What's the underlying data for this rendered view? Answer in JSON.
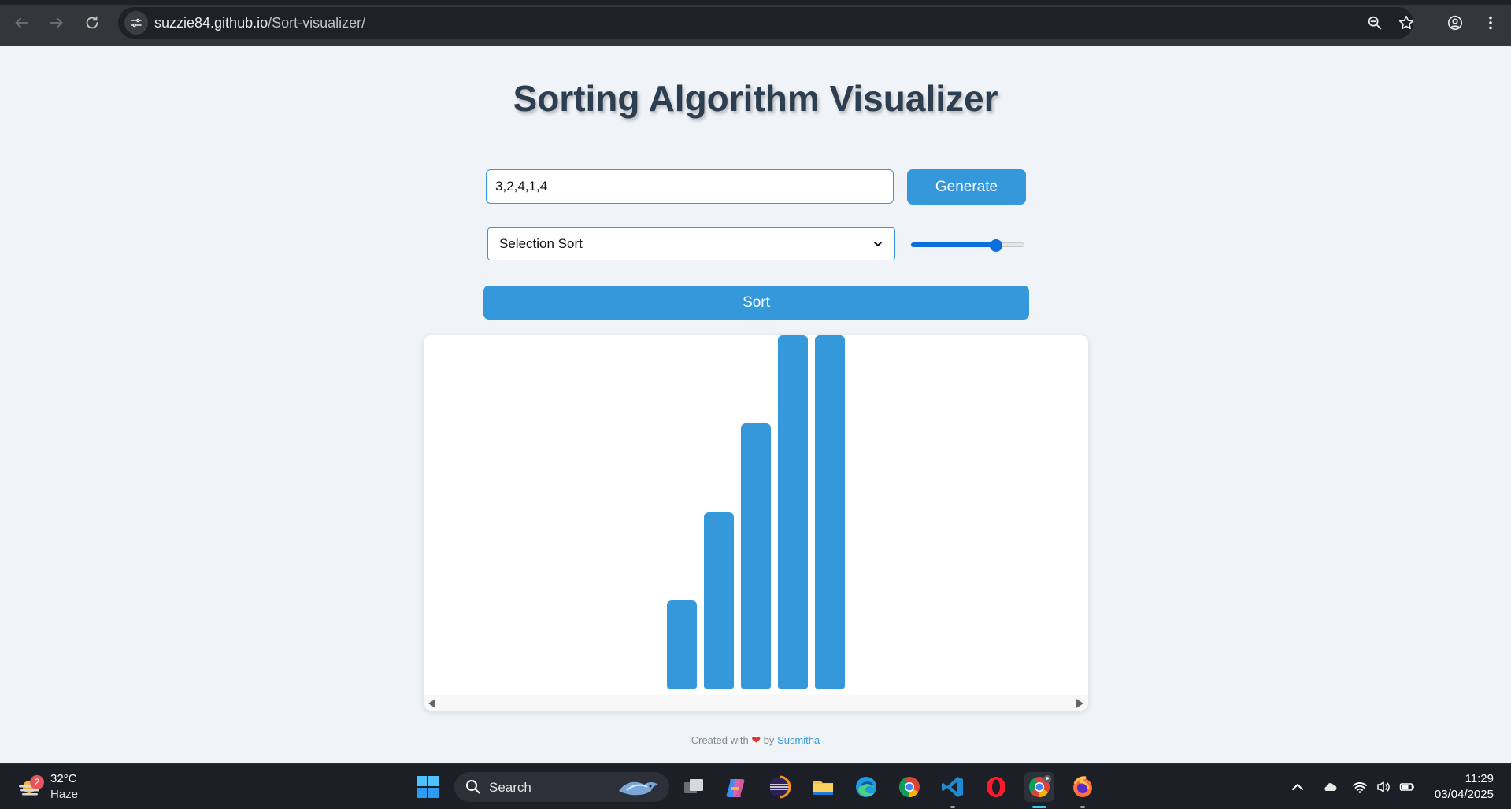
{
  "browser": {
    "url_host": "suzzie84.github.io",
    "url_path": "/Sort-visualizer/"
  },
  "page": {
    "title": "Sorting Algorithm Visualizer",
    "array_input_value": "3,2,4,1,4",
    "generate_label": "Generate",
    "algorithm_selected": "Selection Sort",
    "speed_fraction": 0.75,
    "sort_label": "Sort"
  },
  "chart_data": {
    "type": "bar",
    "values": [
      1,
      2,
      3,
      4,
      4
    ]
  },
  "footer": {
    "created_with": "Created with",
    "by": "by",
    "author": "Susmitha"
  },
  "taskbar": {
    "weather_badge": "2",
    "temperature": "32°C",
    "condition": "Haze",
    "search_label": "Search",
    "time": "11:29",
    "date": "03/04/2025"
  },
  "colors": {
    "accent": "#3498db",
    "title": "#2c3e50",
    "page_bg": "#f0f4f8"
  }
}
